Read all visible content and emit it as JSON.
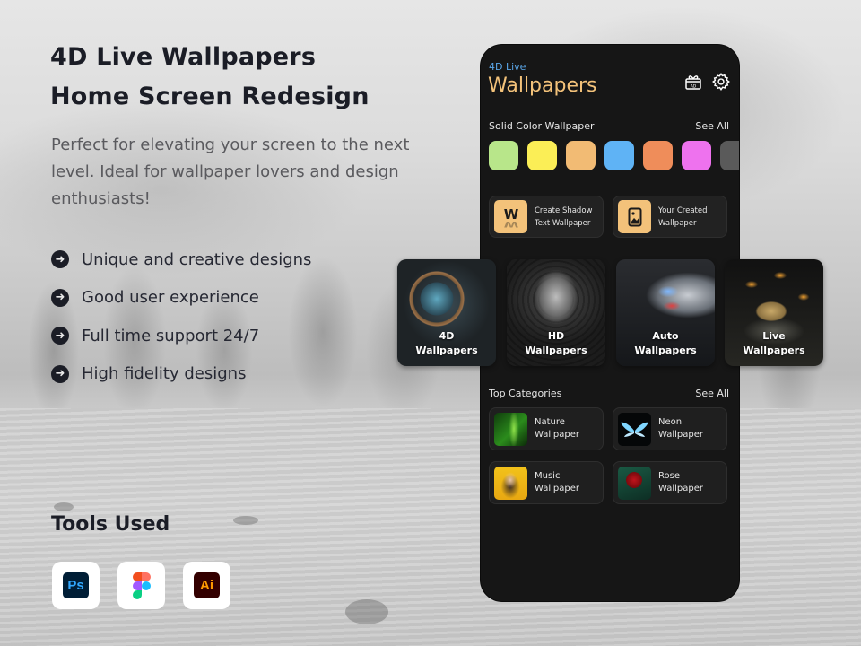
{
  "hero": {
    "title_line1": "4D Live Wallpapers",
    "title_line2": "Home Screen Redesign",
    "subtitle": "Perfect for elevating your screen to the next level. Ideal for wallpaper lovers and design enthusiasts!"
  },
  "features": [
    {
      "icon": "arrow-right-circle-icon",
      "label": "Unique and creative designs"
    },
    {
      "icon": "arrow-right-circle-icon",
      "label": "Good user experience"
    },
    {
      "icon": "arrow-right-circle-icon",
      "label": "Full time support 24/7"
    },
    {
      "icon": "arrow-right-circle-icon",
      "label": "High fidelity designs"
    }
  ],
  "tools": {
    "title": "Tools Used",
    "items": [
      {
        "name": "Photoshop",
        "glyph": "Ps"
      },
      {
        "name": "Figma",
        "glyph": ""
      },
      {
        "name": "Illustrator",
        "glyph": "Ai"
      }
    ]
  },
  "app": {
    "header": {
      "subtitle": "4D Live",
      "title": "Wallpapers",
      "icons": [
        "gift-ad-icon",
        "gear-icon"
      ],
      "gift_badge": "AD"
    },
    "solid_colors": {
      "title": "Solid Color Wallpaper",
      "see_all": "See All",
      "swatches": [
        "#b8e68a",
        "#fbee56",
        "#f2bb74",
        "#5fb3f5",
        "#ef8d5a",
        "#ee72ee",
        "#5a5a5a"
      ]
    },
    "actions": [
      {
        "line1": "Create Shadow",
        "line2": "Text Wallpaper",
        "icon": "shadow-text-icon"
      },
      {
        "line1": "Your Created",
        "line2": "Wallpaper",
        "icon": "phone-image-icon"
      }
    ],
    "feature_cards": [
      {
        "line1": "4D",
        "line2": "Wallpapers"
      },
      {
        "line1": "HD",
        "line2": "Wallpapers"
      },
      {
        "line1": "Auto",
        "line2": "Wallpapers"
      },
      {
        "line1": "Live",
        "line2": "Wallpapers"
      }
    ],
    "top_categories": {
      "title": "Top Categories",
      "see_all": "See All",
      "items": [
        {
          "line1": "Nature",
          "line2": "Wallpaper"
        },
        {
          "line1": "Neon",
          "line2": "Wallpaper"
        },
        {
          "line1": "Music",
          "line2": "Wallpaper"
        },
        {
          "line1": "Rose",
          "line2": "Wallpaper"
        }
      ]
    },
    "colors": {
      "accent": "#f3c27a",
      "subtitle_blue": "#5aa6e8",
      "screen_bg": "#161616"
    }
  }
}
